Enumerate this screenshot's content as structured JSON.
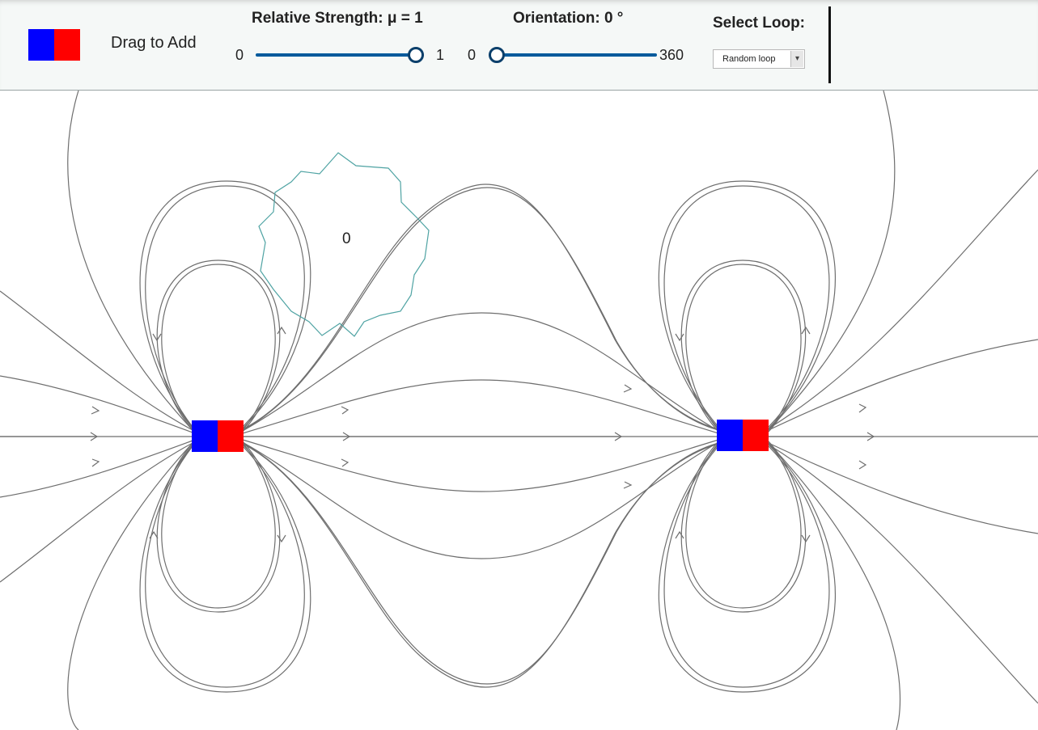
{
  "toolbar": {
    "drag_label": "Drag to Add",
    "strength": {
      "label": "Relative Strength: μ = 1",
      "min": "0",
      "max": "1",
      "value": 1
    },
    "orientation": {
      "label": "Orientation: 0 °",
      "min": "0",
      "max": "360",
      "value": 0
    },
    "loop_select": {
      "label": "Select Loop:",
      "selected": "Random loop"
    }
  },
  "canvas": {
    "loop_flux_value": "0",
    "magnets": [
      {
        "name": "magnet-left",
        "strength": 1,
        "orientation_deg": 0
      },
      {
        "name": "magnet-right",
        "strength": 1,
        "orientation_deg": 0
      }
    ]
  },
  "colors": {
    "south_pole": "#0000ff",
    "north_pole": "#ff0000",
    "field_line": "#6e6e6e",
    "loop": "#4fa3a3",
    "slider": "#005a9c"
  },
  "icons": [
    "magnet-icon",
    "dropdown-arrow-icon",
    "field-arrow-icon"
  ]
}
